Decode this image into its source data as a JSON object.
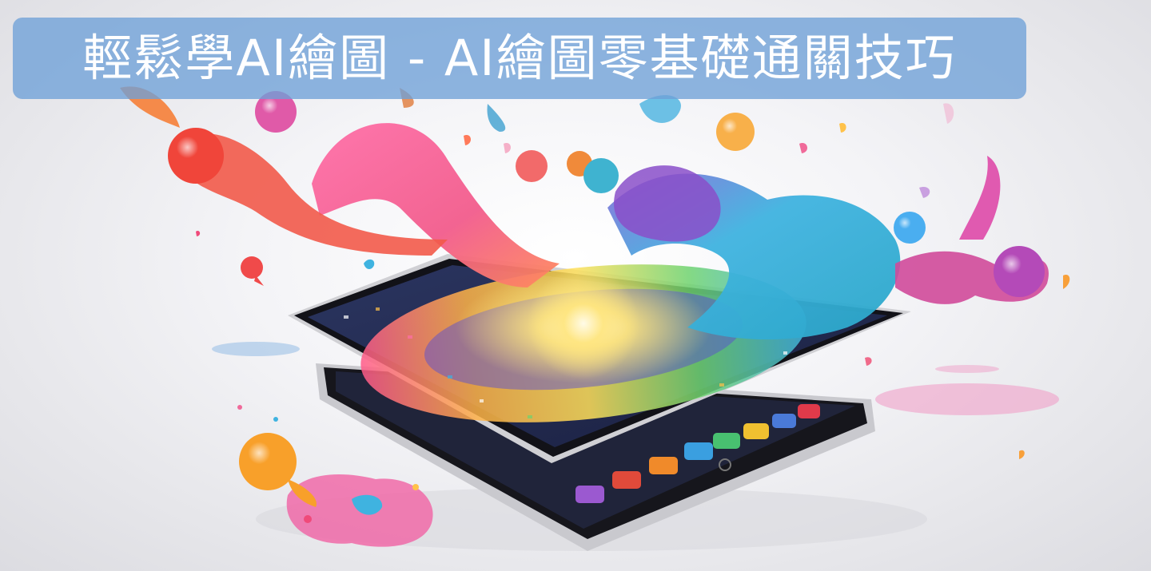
{
  "banner": {
    "title": "輕鬆學AI繪圖 - AI繪圖零基礎通關技巧"
  },
  "colors": {
    "banner_bg": "#6ea0d7",
    "banner_text": "#ffffff",
    "background": "#f4f4f7",
    "tablet_bezel": "#1a1a20",
    "tablet_frame": "#c8c8cc"
  },
  "icons": [
    "paint-splash-icon",
    "app-icon-purple",
    "app-icon-red",
    "app-icon-orange",
    "app-icon-blue",
    "app-icon-green",
    "app-icon-yellow",
    "app-icon-red-2",
    "home-button-icon"
  ]
}
